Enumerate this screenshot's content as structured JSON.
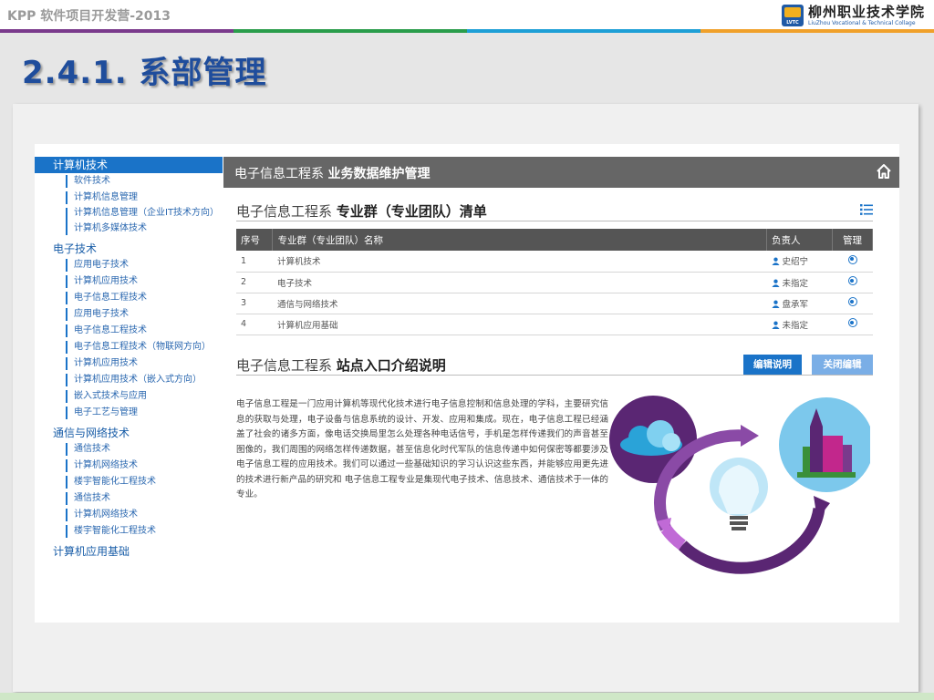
{
  "slide": {
    "header_title": "KPP 软件项目开发营-2013",
    "logo_cn": "柳州职业技术学院",
    "logo_en": "LiuZhou Vocational & Technical Collage",
    "logo_mark": "LVTC",
    "title": "2.4.1. 系部管理",
    "band_colors": [
      "#7a3a8c",
      "#2a9d4b",
      "#1e9fd6",
      "#f0a02a"
    ]
  },
  "app": {
    "header_prefix": "电子信息工程系",
    "header_bold": "业务数据维护管理",
    "sidebar": [
      {
        "category": "计算机技术",
        "active": true,
        "items": [
          "软件技术",
          "计算机信息管理",
          "计算机信息管理（企业IT技术方向）",
          "计算机多媒体技术"
        ]
      },
      {
        "category": "电子技术",
        "active": false,
        "items": [
          "应用电子技术",
          "计算机应用技术",
          "电子信息工程技术",
          "应用电子技术",
          "电子信息工程技术",
          "电子信息工程技术（物联网方向）",
          "计算机应用技术",
          "计算机应用技术（嵌入式方向）",
          "嵌入式技术与应用",
          "电子工艺与管理"
        ]
      },
      {
        "category": "通信与网络技术",
        "active": false,
        "items": [
          "通信技术",
          "计算机网络技术",
          "楼宇智能化工程技术",
          "通信技术",
          "计算机网络技术",
          "楼宇智能化工程技术"
        ]
      },
      {
        "category": "计算机应用基础",
        "active": false,
        "items": []
      }
    ],
    "list_section": {
      "prefix": "电子信息工程系",
      "bold": "专业群（专业团队）清单",
      "columns": [
        "序号",
        "专业群（专业团队）名称",
        "负责人",
        "管理"
      ],
      "rows": [
        {
          "no": "1",
          "name": "计算机技术",
          "owner": "史绍宁"
        },
        {
          "no": "2",
          "name": "电子技术",
          "owner": "未指定"
        },
        {
          "no": "3",
          "name": "通信与网络技术",
          "owner": "盘承军"
        },
        {
          "no": "4",
          "name": "计算机应用基础",
          "owner": "未指定"
        }
      ]
    },
    "intro_section": {
      "prefix": "电子信息工程系",
      "bold": "站点入口介绍说明",
      "edit_label": "编辑说明",
      "close_label": "关闭编辑",
      "text": "电子信息工程是一门应用计算机等现代化技术进行电子信息控制和信息处理的学科，主要研究信息的获取与处理，电子设备与信息系统的设计、开发、应用和集成。现在，电子信息工程已经涵盖了社会的诸多方面，像电话交换局里怎么处理各种电话信号，手机是怎样传递我们的声音甚至图像的，我们周围的网络怎样传递数据，甚至信息化时代军队的信息传递中如何保密等都要涉及电子信息工程的应用技术。我们可以通过一些基础知识的学习认识这些东西，并能够应用更先进的技术进行新产品的研究和 电子信息工程专业是集现代电子技术、信息技术、通信技术于一体的专业。"
    }
  },
  "colors": {
    "accent": "#1a73c8",
    "header_bar": "#666666",
    "title_blue": "#1f4d9c"
  }
}
